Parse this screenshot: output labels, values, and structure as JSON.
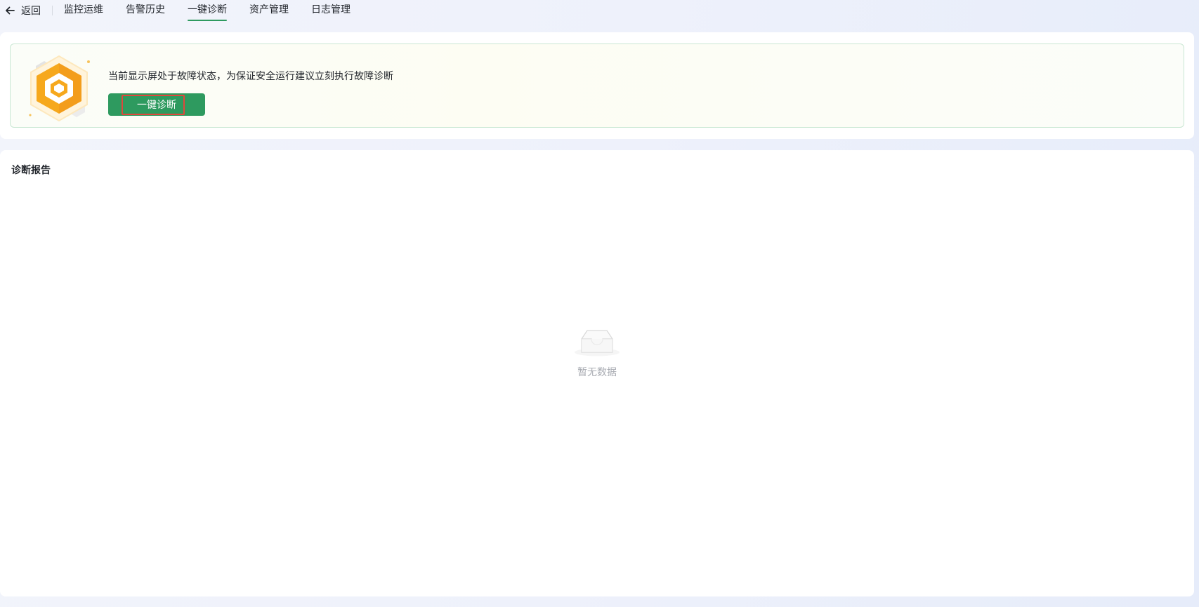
{
  "nav": {
    "back_label": "返回",
    "tabs": [
      {
        "label": "监控运维",
        "active": false
      },
      {
        "label": "告警历史",
        "active": false
      },
      {
        "label": "一键诊断",
        "active": true
      },
      {
        "label": "资产管理",
        "active": false
      },
      {
        "label": "日志管理",
        "active": false
      }
    ]
  },
  "alert": {
    "message": "当前显示屏处于故障状态，为保证安全运行建议立刻执行故障诊断",
    "button_label": "一键诊断",
    "icon": "warning-hexagon-icon"
  },
  "report": {
    "title": "诊断报告",
    "empty_text": "暂无数据",
    "empty_icon": "empty-inbox-icon"
  },
  "colors": {
    "primary": "#2e9a5f",
    "focus_outline": "#e0473c",
    "hexagon": "#f5a623"
  }
}
